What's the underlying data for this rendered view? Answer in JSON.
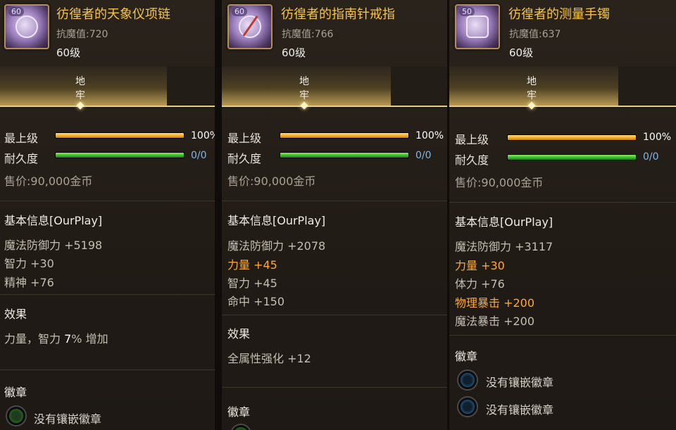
{
  "common": {
    "tab_label_1": "地",
    "tab_label_2": "牢",
    "max_label": "最上级",
    "durability_label": "耐久度",
    "price": "售价:90,000金币",
    "basic_info": "基本信息[OurPlay]",
    "effect_title": "效果",
    "emblem_title": "徽章",
    "no_emblem": "没有镶嵌徽章",
    "level": "60级"
  },
  "items": [
    {
      "icon_level": "60",
      "name": "彷徨者的天象仪项链",
      "resist": "抗魔值:720",
      "max_pct": "100%",
      "max_fill": 1.0,
      "durability": "0/0",
      "durability_fill": 1.0,
      "stats": [
        {
          "text": "魔法防御力 +5198",
          "highlight": false
        },
        {
          "text": "智力 +30",
          "highlight": false
        },
        {
          "text": "精神 +76",
          "highlight": false
        }
      ],
      "effect": {
        "prefix": "力量，智力 ",
        "value": "7",
        "suffix": "% 增加"
      },
      "emblem_slots": 1
    },
    {
      "icon_level": "60",
      "name": "彷徨者的指南针戒指",
      "resist": "抗魔值:766",
      "max_pct": "100%",
      "max_fill": 1.0,
      "durability": "0/0",
      "durability_fill": 1.0,
      "stats": [
        {
          "text": "魔法防御力 +2078",
          "highlight": false
        },
        {
          "text": "力量 +45",
          "highlight": true
        },
        {
          "text": "智力 +45",
          "highlight": false
        },
        {
          "text": "命中 +150",
          "highlight": false
        }
      ],
      "effect_line": "全属性强化 +12"
    },
    {
      "icon_level": "50",
      "name": "彷徨者的测量手镯",
      "resist": "抗魔值:637",
      "max_pct": "100%",
      "max_fill": 1.0,
      "durability": "0/0",
      "durability_fill": 1.0,
      "stats": [
        {
          "text": "魔法防御力 +3117",
          "highlight": false
        },
        {
          "text": "力量 +30",
          "highlight": true
        },
        {
          "text": "体力 +76",
          "highlight": false
        },
        {
          "text": "物理暴击 +200",
          "highlight": true
        },
        {
          "text": "魔法暴击 +200",
          "highlight": false
        }
      ],
      "emblem_slots": 2
    }
  ]
}
